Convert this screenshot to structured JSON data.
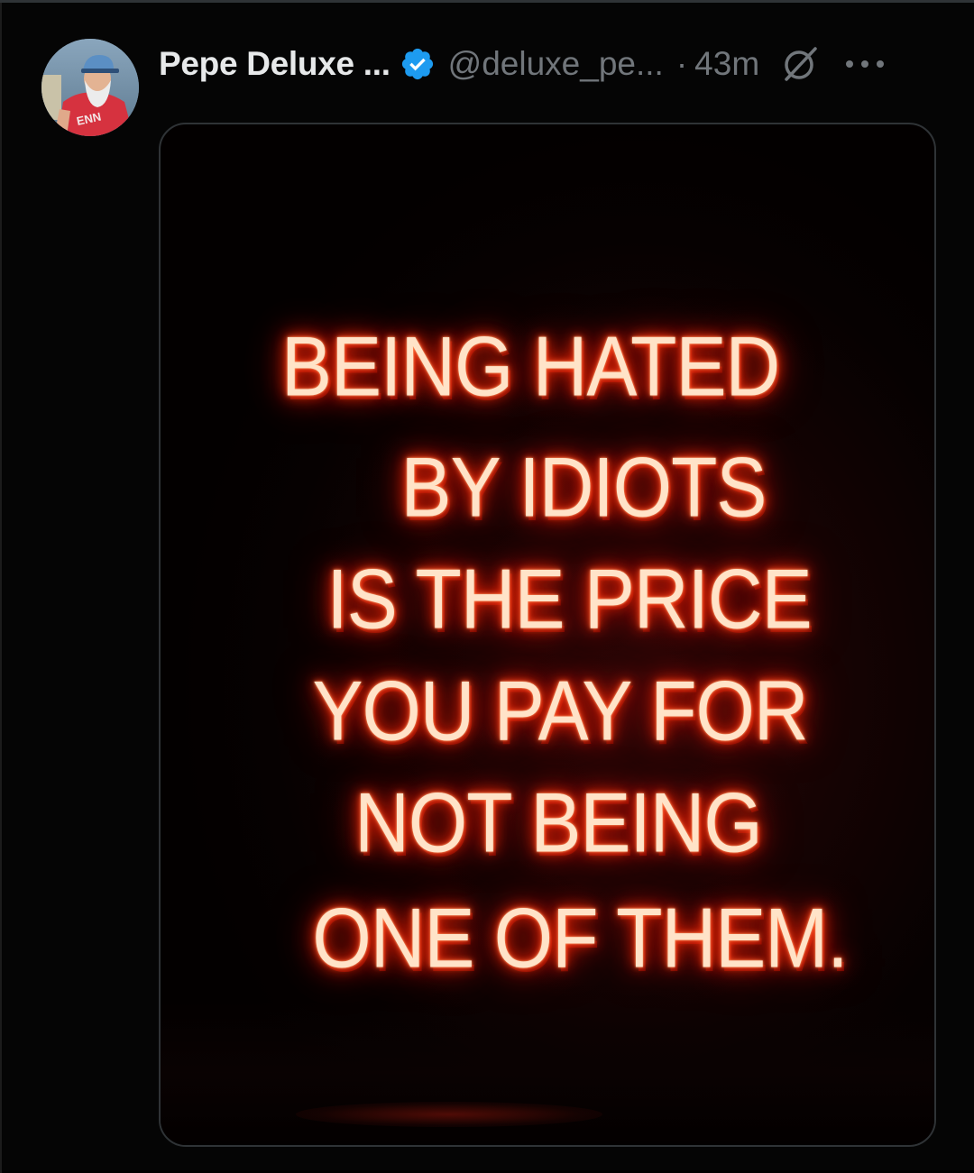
{
  "post": {
    "author": {
      "display_name": "Pepe Deluxe ...",
      "handle": "@deluxe_pe...",
      "verified": true,
      "avatar_icon": "avatar-photo"
    },
    "separator": "·",
    "time": "43m",
    "icons": {
      "verified": "verified-badge-icon",
      "grok": "grok-icon",
      "more": "more-options-icon"
    },
    "media": {
      "neon_lines": [
        "BEING HATED",
        "BY IDIOTS",
        "IS THE PRICE",
        "YOU PAY FOR",
        "NOT BEING",
        "ONE OF THEM."
      ]
    }
  },
  "colors": {
    "background": "#050505",
    "text_primary": "#e7e9ea",
    "text_secondary": "#71767b",
    "verified_blue": "#1d9bf0",
    "neon_red": "#ff2a0a",
    "border": "#2f3336"
  }
}
